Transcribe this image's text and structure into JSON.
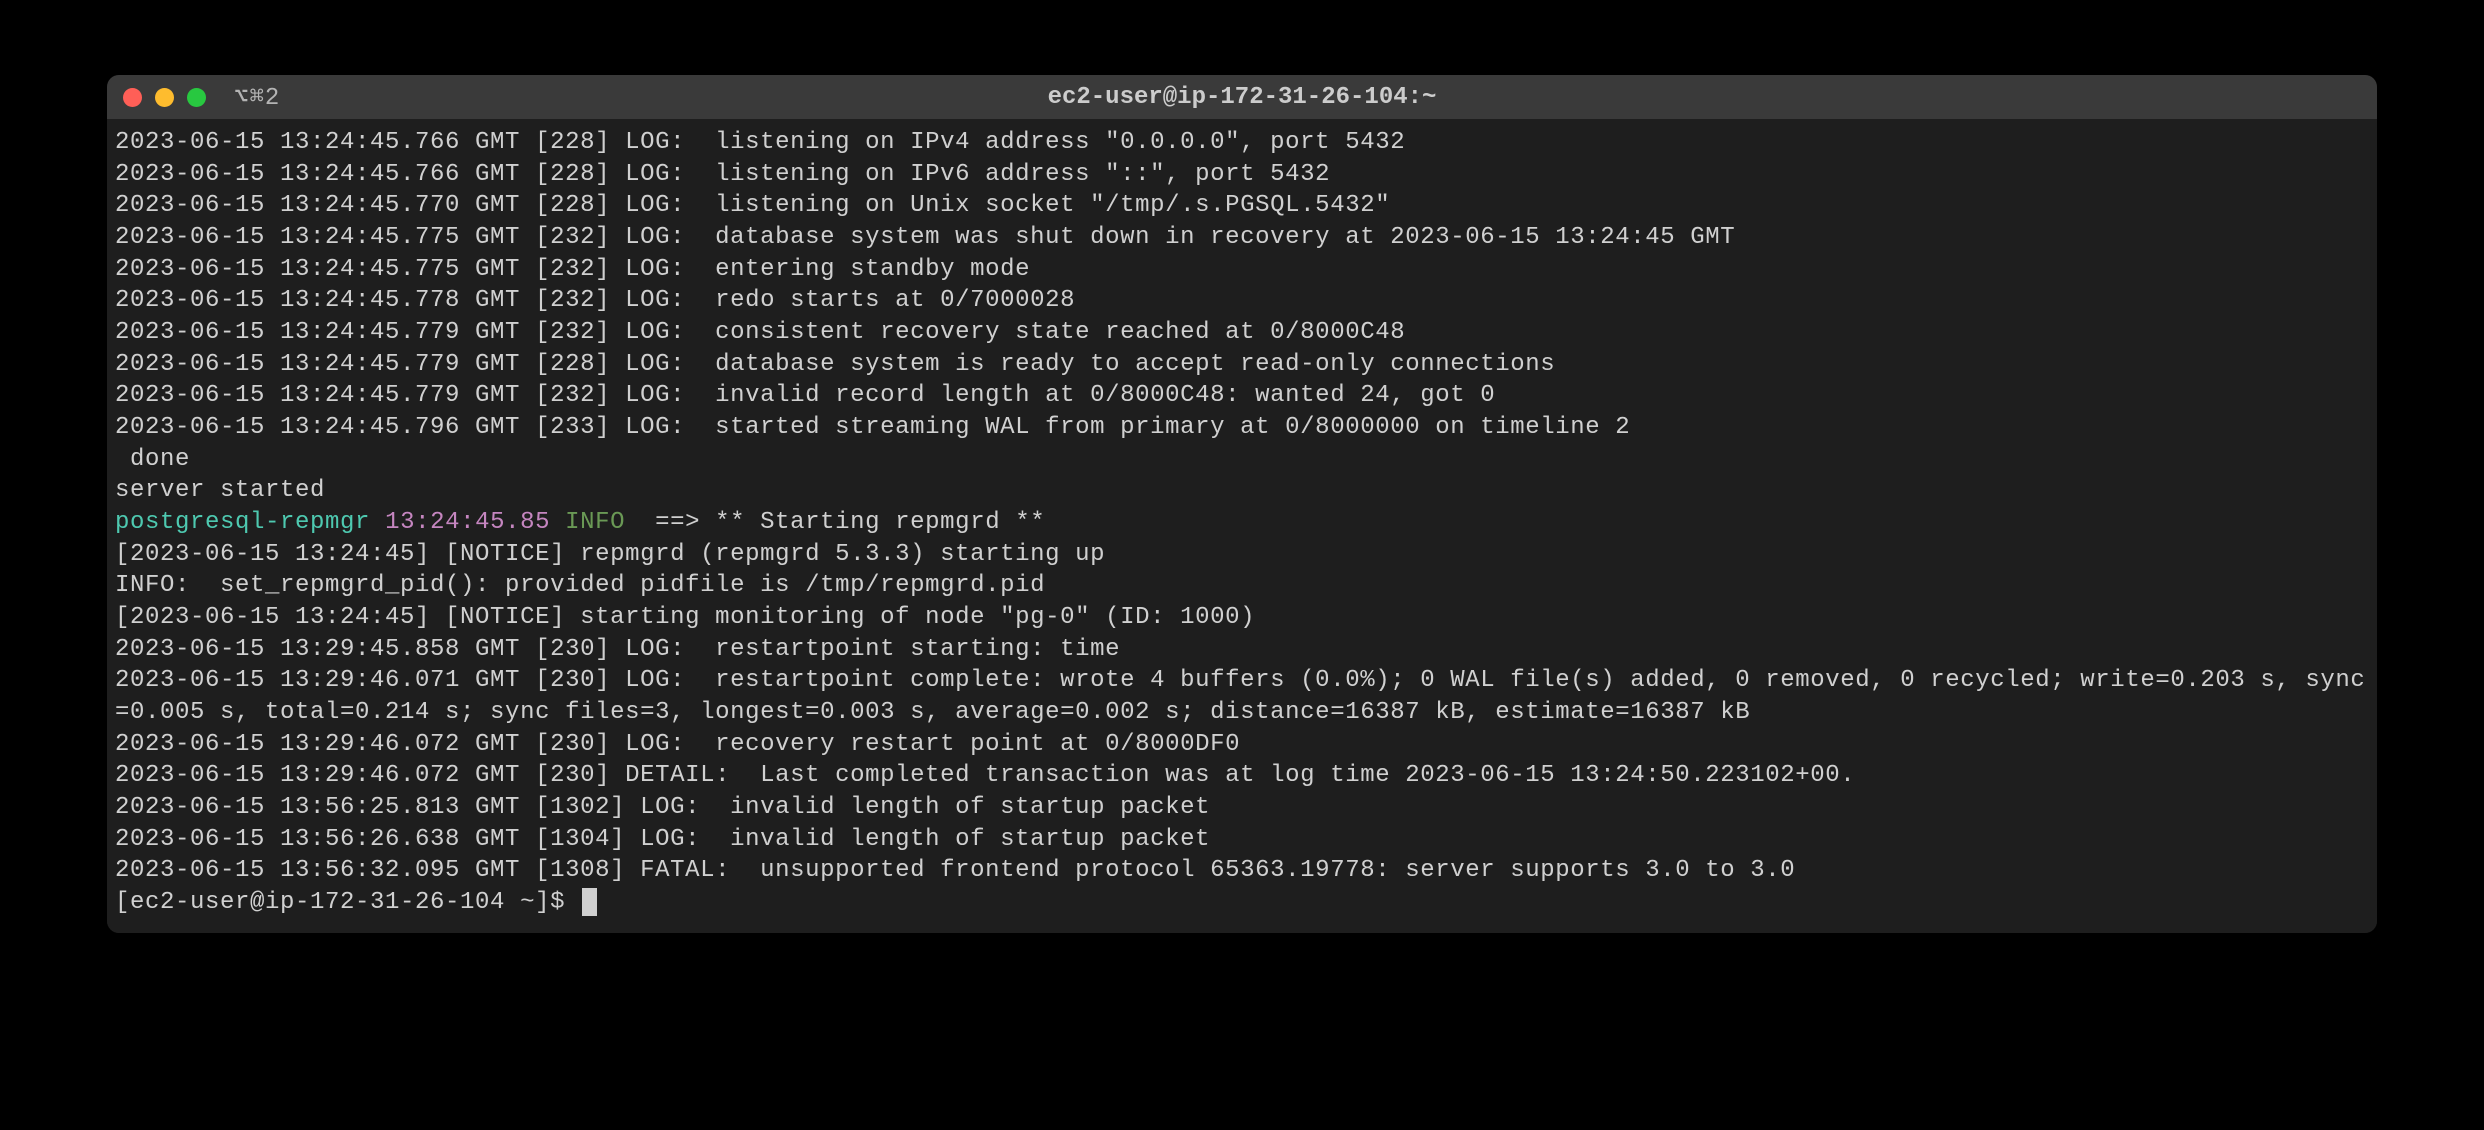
{
  "titlebar": {
    "tab_indicator": "⌥⌘2",
    "title": "ec2-user@ip-172-31-26-104:~"
  },
  "lines": [
    {
      "type": "plain",
      "text": "2023-06-15 13:24:45.766 GMT [228] LOG:  listening on IPv4 address \"0.0.0.0\", port 5432"
    },
    {
      "type": "plain",
      "text": "2023-06-15 13:24:45.766 GMT [228] LOG:  listening on IPv6 address \"::\", port 5432"
    },
    {
      "type": "plain",
      "text": "2023-06-15 13:24:45.770 GMT [228] LOG:  listening on Unix socket \"/tmp/.s.PGSQL.5432\""
    },
    {
      "type": "plain",
      "text": "2023-06-15 13:24:45.775 GMT [232] LOG:  database system was shut down in recovery at 2023-06-15 13:24:45 GMT"
    },
    {
      "type": "plain",
      "text": "2023-06-15 13:24:45.775 GMT [232] LOG:  entering standby mode"
    },
    {
      "type": "plain",
      "text": "2023-06-15 13:24:45.778 GMT [232] LOG:  redo starts at 0/7000028"
    },
    {
      "type": "plain",
      "text": "2023-06-15 13:24:45.779 GMT [232] LOG:  consistent recovery state reached at 0/8000C48"
    },
    {
      "type": "plain",
      "text": "2023-06-15 13:24:45.779 GMT [228] LOG:  database system is ready to accept read-only connections"
    },
    {
      "type": "plain",
      "text": "2023-06-15 13:24:45.779 GMT [232] LOG:  invalid record length at 0/8000C48: wanted 24, got 0"
    },
    {
      "type": "plain",
      "text": "2023-06-15 13:24:45.796 GMT [233] LOG:  started streaming WAL from primary at 0/8000000 on timeline 2"
    },
    {
      "type": "plain",
      "text": " done"
    },
    {
      "type": "plain",
      "text": "server started"
    },
    {
      "type": "colored",
      "service": "postgresql-repmgr",
      "time": "13:24:45.85",
      "level": "INFO ",
      "rest": "==> ** Starting repmgrd **"
    },
    {
      "type": "plain",
      "text": "[2023-06-15 13:24:45] [NOTICE] repmgrd (repmgrd 5.3.3) starting up"
    },
    {
      "type": "plain",
      "text": "INFO:  set_repmgrd_pid(): provided pidfile is /tmp/repmgrd.pid"
    },
    {
      "type": "plain",
      "text": "[2023-06-15 13:24:45] [NOTICE] starting monitoring of node \"pg-0\" (ID: 1000)"
    },
    {
      "type": "plain",
      "text": "2023-06-15 13:29:45.858 GMT [230] LOG:  restartpoint starting: time"
    },
    {
      "type": "plain",
      "text": "2023-06-15 13:29:46.071 GMT [230] LOG:  restartpoint complete: wrote 4 buffers (0.0%); 0 WAL file(s) added, 0 removed, 0 recycled; write=0.203 s, sync=0.005 s, total=0.214 s; sync files=3, longest=0.003 s, average=0.002 s; distance=16387 kB, estimate=16387 kB"
    },
    {
      "type": "plain",
      "text": "2023-06-15 13:29:46.072 GMT [230] LOG:  recovery restart point at 0/8000DF0"
    },
    {
      "type": "plain",
      "text": "2023-06-15 13:29:46.072 GMT [230] DETAIL:  Last completed transaction was at log time 2023-06-15 13:24:50.223102+00."
    },
    {
      "type": "plain",
      "text": "2023-06-15 13:56:25.813 GMT [1302] LOG:  invalid length of startup packet"
    },
    {
      "type": "plain",
      "text": "2023-06-15 13:56:26.638 GMT [1304] LOG:  invalid length of startup packet"
    },
    {
      "type": "plain",
      "text": "2023-06-15 13:56:32.095 GMT [1308] FATAL:  unsupported frontend protocol 65363.19778: server supports 3.0 to 3.0"
    }
  ],
  "prompt": {
    "text": "[ec2-user@ip-172-31-26-104 ~]$ "
  }
}
